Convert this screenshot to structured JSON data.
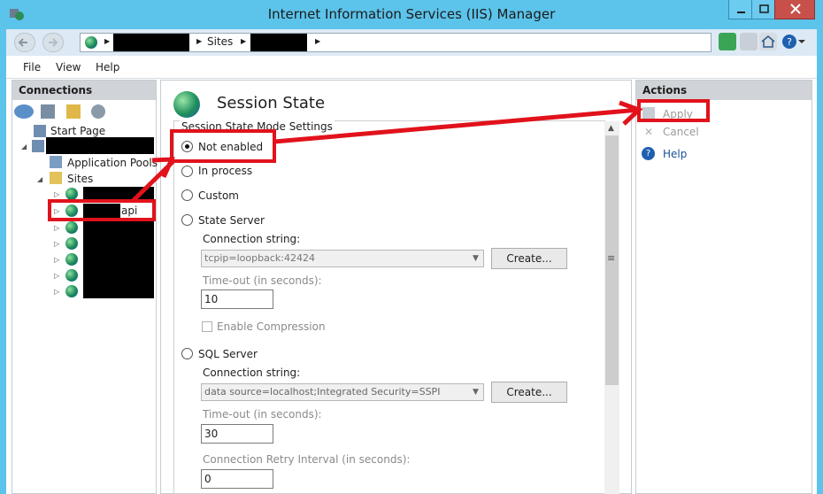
{
  "window": {
    "title": "Internet Information Services (IIS) Manager"
  },
  "breadcrumb": {
    "segment_sites": "Sites"
  },
  "menu": {
    "file": "File",
    "view": "View",
    "help": "Help"
  },
  "connections": {
    "header": "Connections",
    "start_page": "Start Page",
    "app_pools": "Application Pools",
    "sites": "Sites",
    "api_suffix": "api"
  },
  "main": {
    "title": "Session State",
    "group_label": "Session State Mode Settings",
    "options": {
      "not_enabled": "Not enabled",
      "in_process": "In process",
      "custom": "Custom",
      "state_server": "State Server",
      "sql_server": "SQL Server"
    },
    "state_server": {
      "conn_label": "Connection string:",
      "conn_value": "tcpip=loopback:42424",
      "create_label": "Create...",
      "timeout_label": "Time-out (in seconds):",
      "timeout_value": "10",
      "compression_label": "Enable Compression"
    },
    "sql_server": {
      "conn_label": "Connection string:",
      "conn_value": "data source=localhost;Integrated Security=SSPI",
      "create_label": "Create...",
      "timeout_label": "Time-out (in seconds):",
      "timeout_value": "30",
      "retry_label": "Connection Retry Interval (in seconds):",
      "retry_value": "0"
    }
  },
  "actions": {
    "header": "Actions",
    "apply": "Apply",
    "cancel": "Cancel",
    "help": "Help"
  },
  "colors": {
    "titlebar": "#5cc3ea",
    "annotation": "#e1121b",
    "selected_radio": "#111111"
  }
}
